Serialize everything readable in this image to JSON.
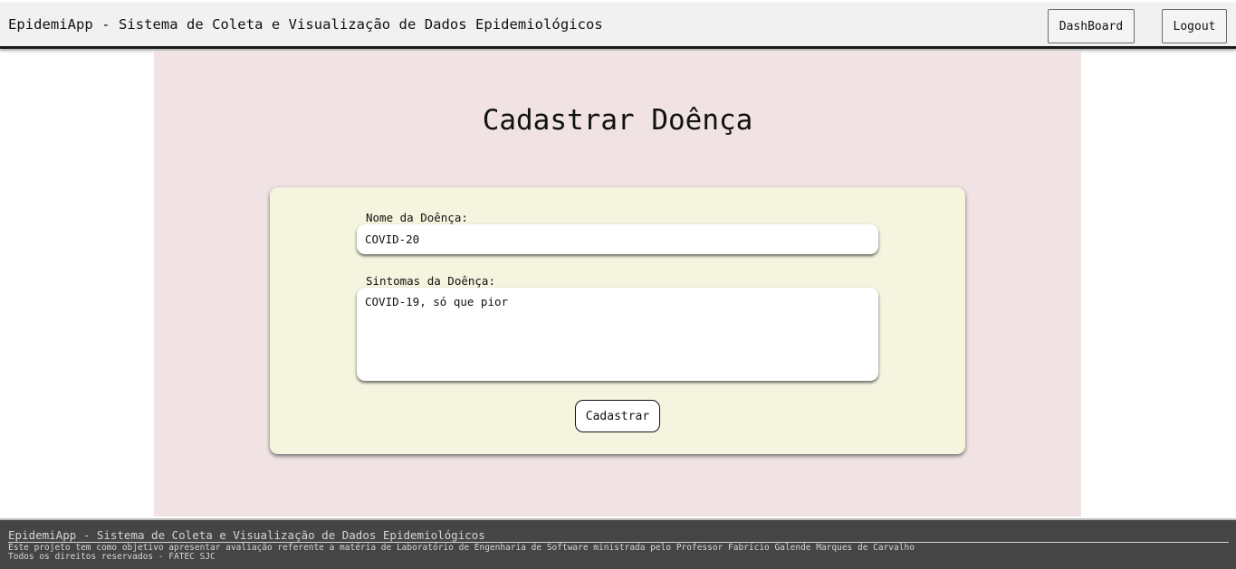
{
  "header": {
    "title": "EpidemiApp - Sistema de Coleta e Visualização de Dados Epidemiológicos",
    "dashboard_label": "DashBoard",
    "logout_label": "Logout"
  },
  "page": {
    "title": "Cadastrar Doênça"
  },
  "form": {
    "name_label": "Nome da Doênça:",
    "name_value": "COVID-20",
    "symptoms_label": "Sintomas da Doênça:",
    "symptoms_value": "COVID-19, só que pior",
    "submit_label": "Cadastrar"
  },
  "footer": {
    "title": "EpidemiApp - Sistema de Coleta e Visualização de Dados Epidemiológicos",
    "description": "Este projeto tem como objetivo apresentar avaliação referente a matéria de Laboratório de Engenharia de Software ministrada pelo Professor Fabrício Galende Marques de Carvalho",
    "rights": "Todos os direitos reservados - FATEC SJC"
  },
  "colors": {
    "header_bg": "#f1f1f1",
    "main_bg": "#f1e2e3",
    "card_bg": "#f4f4df",
    "footer_bg": "#454545"
  }
}
